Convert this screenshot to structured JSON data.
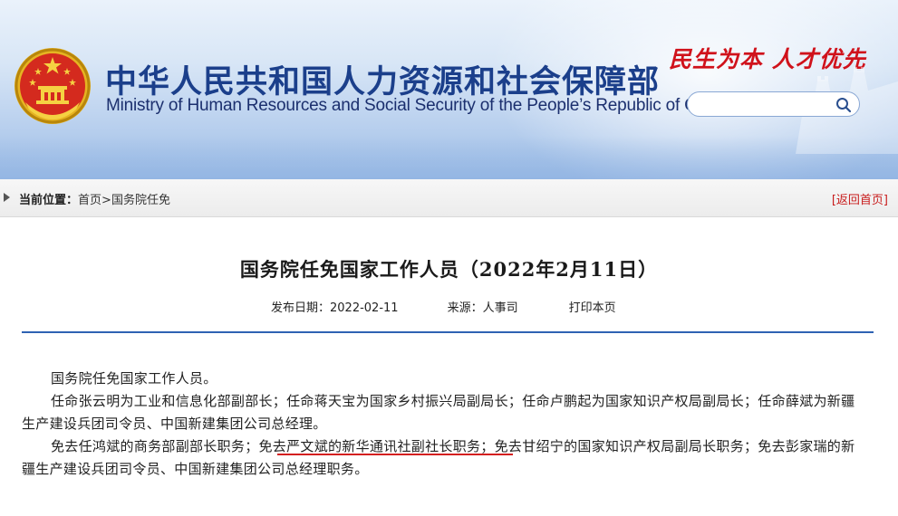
{
  "header": {
    "title_cn": "中华人民共和国人力资源和社会保障部",
    "title_en": "Ministry of Human Resources and Social Security of the People’s Republic of China",
    "slogan": "民生为本  人才优先",
    "emblem_icon": "national-emblem-icon",
    "search": {
      "placeholder": "",
      "value": "",
      "icon": "search-icon"
    }
  },
  "breadcrumb": {
    "label": "当前位置：",
    "home": "首页",
    "separator": ">",
    "current": "国务院任免",
    "back_home": "[返回首页]"
  },
  "article": {
    "title": "国务院任免国家工作人员（2022年2月11日）",
    "publish_date": "发布日期：2022-02-11",
    "source": "来源：人事司",
    "print": "打印本页",
    "paragraphs": [
      "国务院任免国家工作人员。",
      "任命张云明为工业和信息化部副部长；任命蒋天宝为国家乡村振兴局副局长；任命卢鹏起为国家知识产权局副局长；任命薛斌为新疆生产建设兵团司令员、中国新建集团公司总经理。",
      "免去任鸿斌的商务部副部长职务；免去严文斌的新华通讯社副社长职务；免去甘绍宁的国家知识产权局副局长职务；免去彭家瑞的新疆生产建设兵团司令员、中国新建集团公司总经理职务。"
    ]
  },
  "colors": {
    "title_blue": "#1b3f8b",
    "slogan_red": "#d0121b",
    "rule_blue": "#2e62b3",
    "highlight_red": "#d41f1f"
  }
}
